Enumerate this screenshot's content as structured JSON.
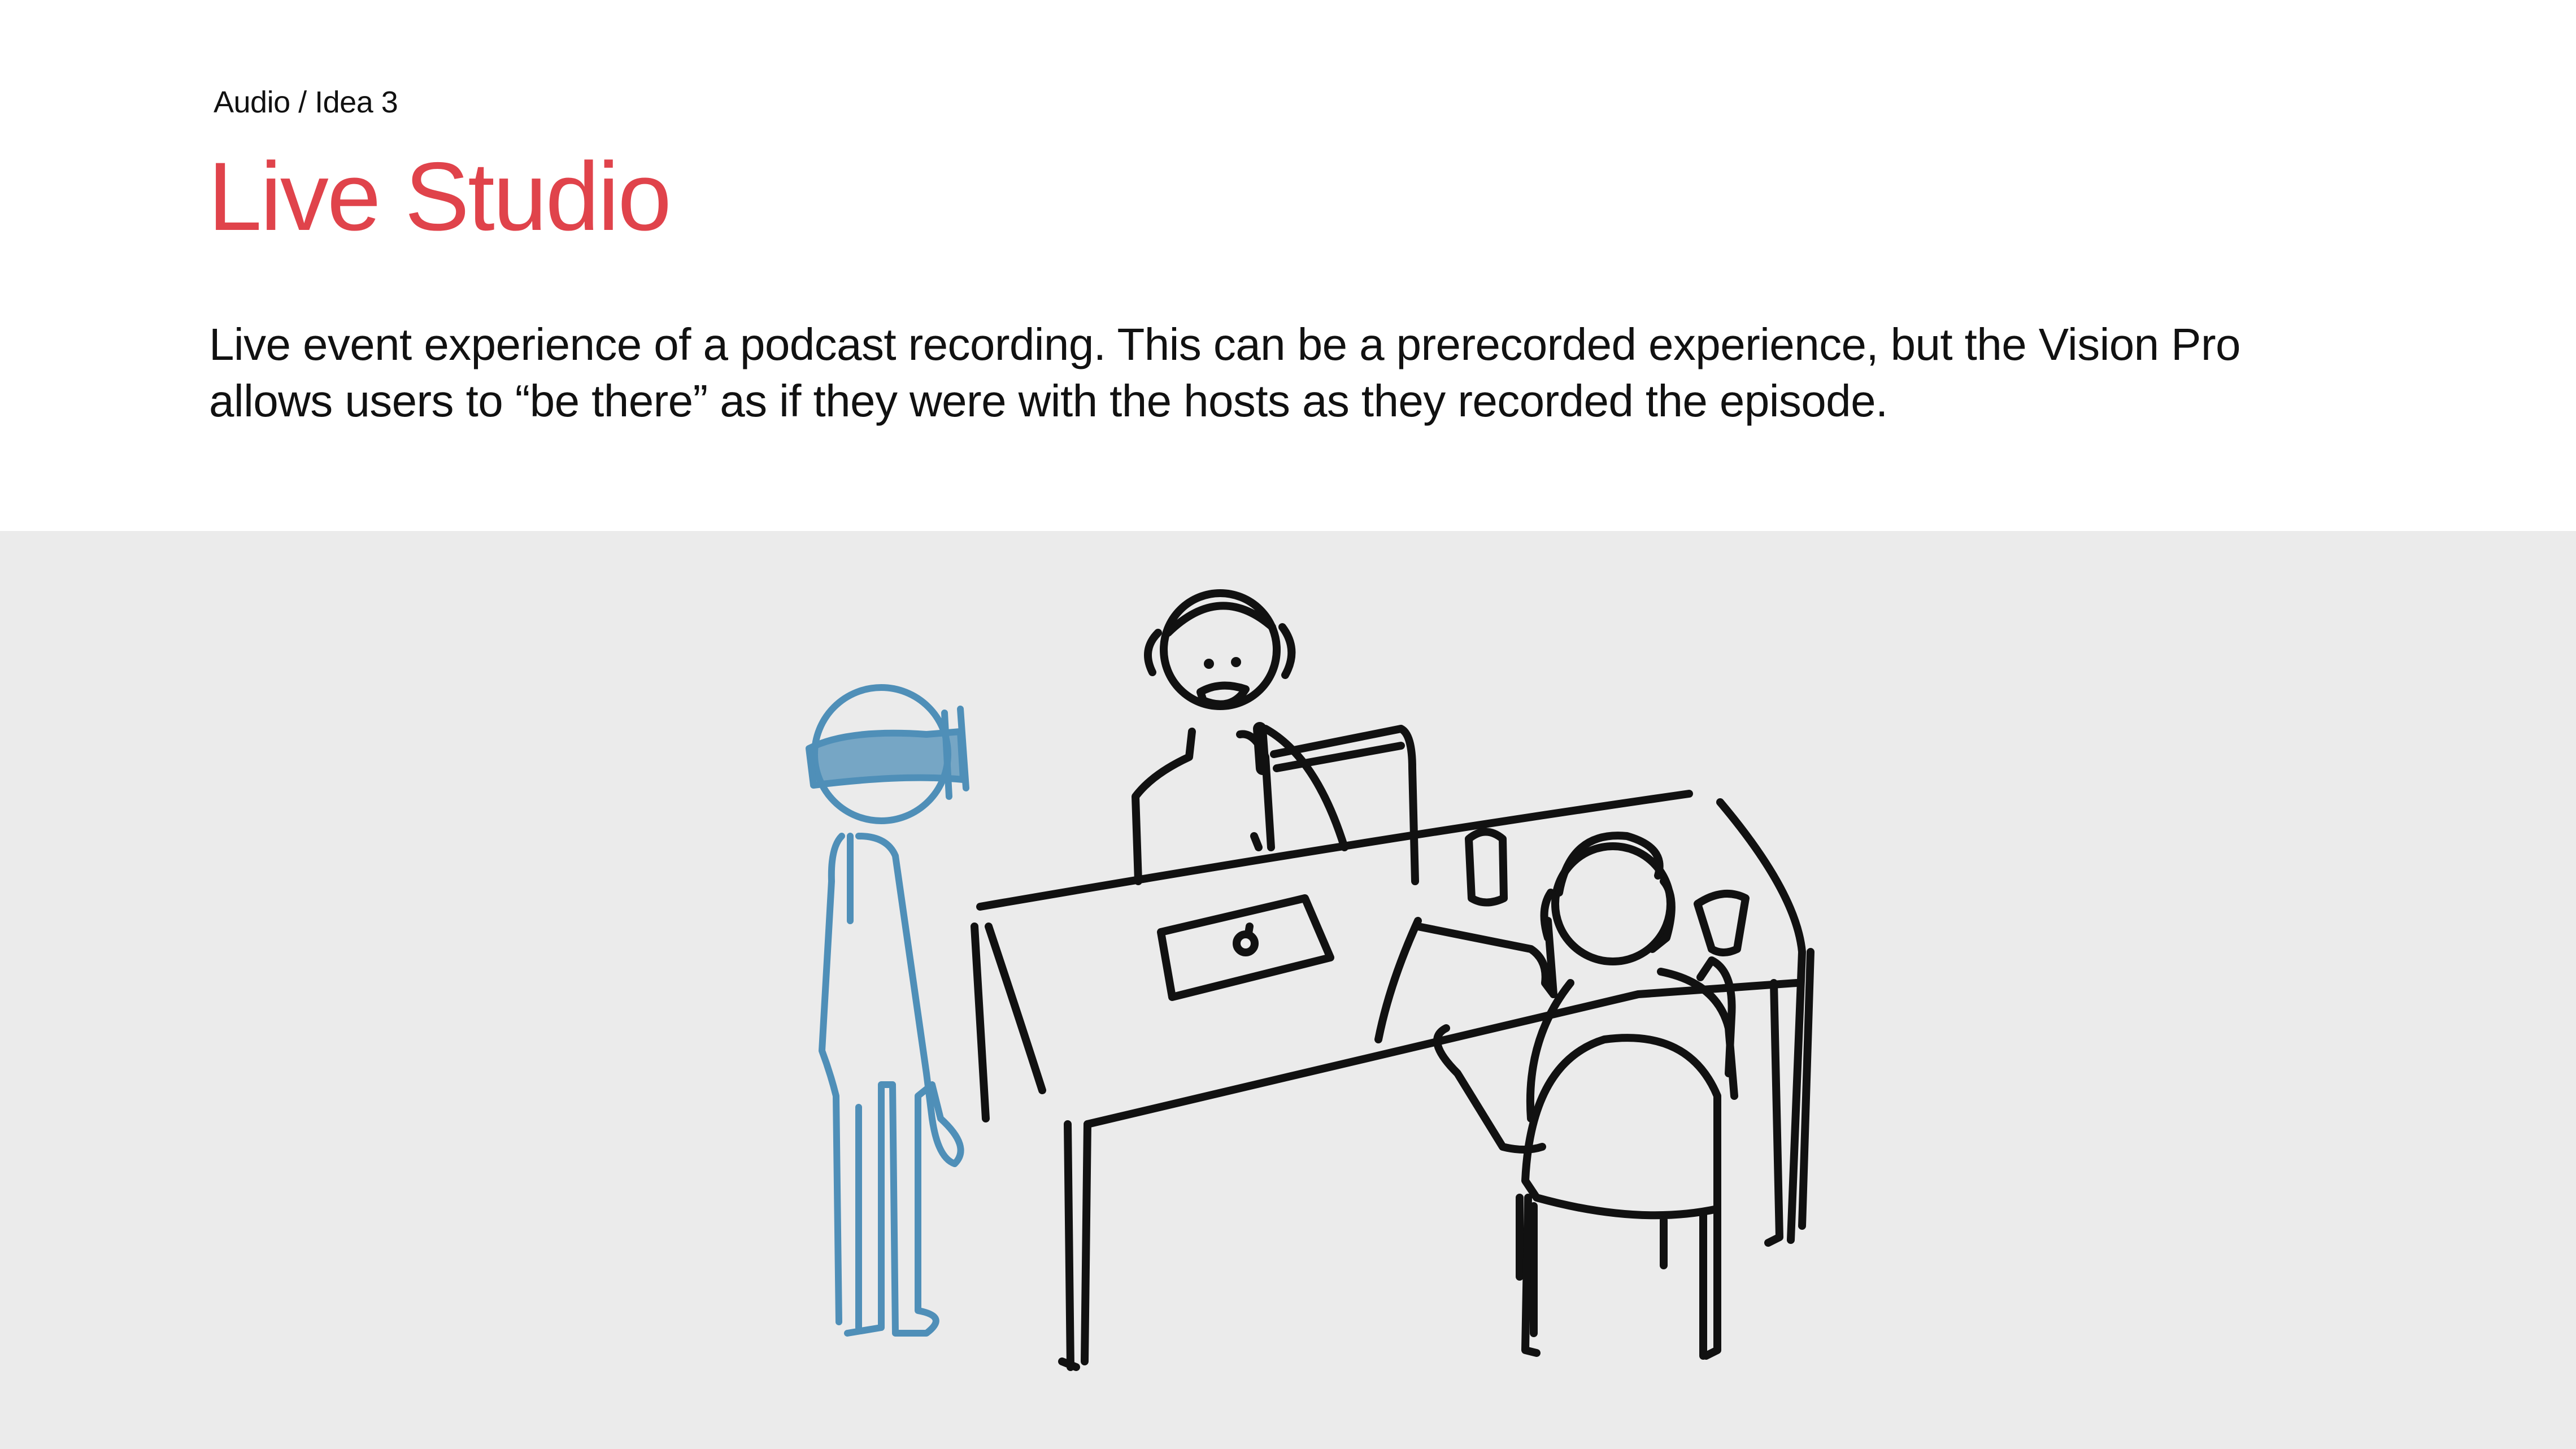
{
  "slide": {
    "breadcrumb": "Audio / Idea 3",
    "title": "Live Studio",
    "description": "Live event experience of a podcast recording. This can be a prerecorded experience, but the Vision Pro allows users to “be there” as if they were with the hosts as they recorded the episode.",
    "title_color": "#e0434b"
  },
  "illustration": {
    "background_color": "#ebebeb",
    "viewer_color": "#4f8fb8",
    "ink_color": "#111111"
  }
}
